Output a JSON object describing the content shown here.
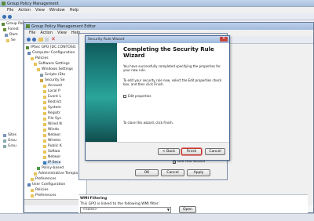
{
  "gpm": {
    "title": "Group Policy Management",
    "menu": [
      "File",
      "Action",
      "View",
      "Window",
      "Help"
    ],
    "tree": [
      "Group Policy",
      "Forest",
      "Dom",
      "Se",
      "Sites",
      "Grou",
      "Grou"
    ]
  },
  "gpe": {
    "title": "Group Policy Management Editor",
    "menu": [
      "File",
      "Action",
      "View",
      "Help"
    ],
    "tree": [
      {
        "label": "IPSec GPO [DC.CONTOSO.",
        "icon": "gpo-icon"
      },
      {
        "label": "Computer Configuration",
        "icon": "computer-icon"
      },
      {
        "label": "Policies",
        "icon": "folder-icon"
      },
      {
        "label": "Software Settings",
        "icon": "folder-icon"
      },
      {
        "label": "Windows Settings",
        "icon": "folder-icon"
      },
      {
        "label": "Scripts (Sta",
        "icon": "script-icon"
      },
      {
        "label": "Security Se",
        "icon": "security-icon"
      },
      {
        "label": "Account",
        "icon": "folder-icon"
      },
      {
        "label": "Local P",
        "icon": "folder-icon"
      },
      {
        "label": "Event L",
        "icon": "folder-icon"
      },
      {
        "label": "Restrict",
        "icon": "folder-icon"
      },
      {
        "label": "System",
        "icon": "folder-icon"
      },
      {
        "label": "Registr",
        "icon": "folder-icon"
      },
      {
        "label": "File Sys",
        "icon": "folder-icon"
      },
      {
        "label": "Wired N",
        "icon": "folder-icon"
      },
      {
        "label": "Windo",
        "icon": "folder-icon"
      },
      {
        "label": "Networ",
        "icon": "folder-icon"
      },
      {
        "label": "Wireles",
        "icon": "folder-icon"
      },
      {
        "label": "Public K",
        "icon": "folder-icon"
      },
      {
        "label": "Softwa",
        "icon": "folder-icon"
      },
      {
        "label": "Networ",
        "icon": "folder-icon"
      },
      {
        "label": "IP Secu",
        "icon": "ipsec-icon"
      },
      {
        "label": "Policy-based",
        "icon": "chart-icon"
      },
      {
        "label": "Administrative Templa",
        "icon": "folder-icon"
      },
      {
        "label": "Preferences",
        "icon": "folder-icon"
      },
      {
        "label": "User Configuration",
        "icon": "user-icon"
      },
      {
        "label": "Policies",
        "icon": "folder-icon"
      },
      {
        "label": "Preferences",
        "icon": "folder-icon"
      }
    ]
  },
  "wizard": {
    "window_title": "Security Rule Wizard",
    "heading": "Completing the Security Rule Wizard",
    "para1": "You have successfully completed specifying the properties for your new rule.",
    "para2": "To edit your security rule now, select the Edit properties check box, and then click Finish.",
    "checkbox_label": "Edit properties",
    "checkbox_checked": false,
    "para3": "To close this wizard, click Finish.",
    "back_label": "< Back",
    "finish_label": "Finish",
    "cancel_label": "Cancel"
  },
  "props": {
    "use_add_wizard": "Use Add Wizard",
    "ok": "OK",
    "cancel": "Cancel",
    "apply": "Apply"
  },
  "wmi": {
    "header": "WMI Filtering",
    "text": "This GPO is linked to the following WMI filter:",
    "select_value": "<none>",
    "open_label": "Open"
  }
}
